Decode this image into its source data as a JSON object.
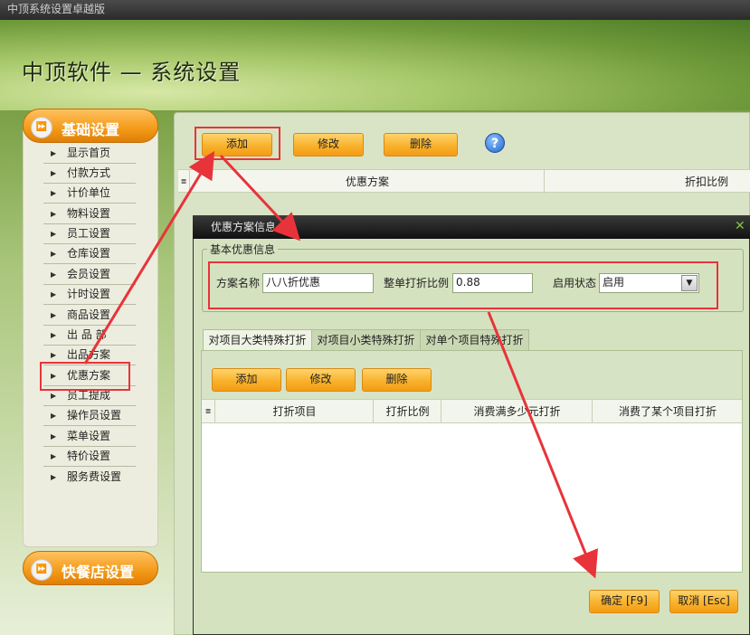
{
  "window": {
    "title": "中顶系统设置卓越版"
  },
  "header": {
    "title": "中顶软件 — 系统设置"
  },
  "sidebar": {
    "section_title": "基础设置",
    "items": [
      {
        "label": "显示首页"
      },
      {
        "label": "付款方式"
      },
      {
        "label": "计价单位"
      },
      {
        "label": "物料设置"
      },
      {
        "label": "员工设置"
      },
      {
        "label": "仓库设置"
      },
      {
        "label": "会员设置"
      },
      {
        "label": "计时设置"
      },
      {
        "label": "商品设置"
      },
      {
        "label": "出 品 部"
      },
      {
        "label": "出品方案"
      },
      {
        "label": "优惠方案"
      },
      {
        "label": "员工提成"
      },
      {
        "label": "操作员设置"
      },
      {
        "label": "菜单设置"
      },
      {
        "label": "特价设置"
      },
      {
        "label": "服务费设置"
      }
    ],
    "footer_section_title": "快餐店设置"
  },
  "toolbar": {
    "add_label": "添加",
    "edit_label": "修改",
    "delete_label": "删除",
    "help_icon": "help-icon"
  },
  "main_grid": {
    "columns": [
      "优惠方案",
      "折扣比例"
    ]
  },
  "dialog": {
    "title": "优惠方案信息",
    "group_title": "基本优惠信息",
    "fields": {
      "name_label": "方案名称",
      "name_value": "八八折优惠",
      "ratio_label": "整单打折比例",
      "ratio_value": "0.88",
      "status_label": "启用状态",
      "status_value": "启用"
    },
    "tabs": [
      {
        "label": "对项目大类特殊打折",
        "active": true
      },
      {
        "label": "对项目小类特殊打折",
        "active": false
      },
      {
        "label": "对单个项目特殊打折",
        "active": false
      }
    ],
    "inner_toolbar": {
      "add_label": "添加",
      "edit_label": "修改",
      "delete_label": "删除"
    },
    "inner_grid": {
      "columns": [
        "打折项目",
        "打折比例",
        "消费满多少元打折",
        "消费了某个项目打折"
      ]
    },
    "ok_label": "确定 [F9]",
    "cancel_label": "取消 [Esc]"
  },
  "colors": {
    "accent_orange": "#f59b14",
    "annotation_red": "#e8333a",
    "panel_green": "#d9e3c6"
  }
}
